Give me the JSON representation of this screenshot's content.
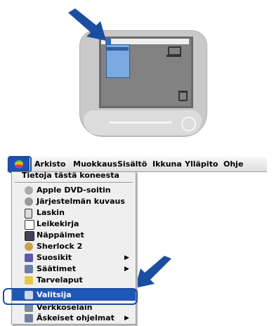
{
  "menubar": {
    "items": [
      {
        "label": "Arkisto"
      },
      {
        "label": "Muokkaus"
      },
      {
        "label": "Sisältö"
      },
      {
        "label": "Ikkuna"
      },
      {
        "label": "Ylläpito"
      },
      {
        "label": "Ohje"
      }
    ]
  },
  "apple_menu": {
    "header": "Tietoja tästä koneesta",
    "items": [
      {
        "label": "Apple DVD-soitin",
        "icon": "dvd-icon"
      },
      {
        "label": "Järjestelmän kuvaus",
        "icon": "system-profile-icon"
      },
      {
        "label": "Laskin",
        "icon": "calculator-icon"
      },
      {
        "label": "Leikekirja",
        "icon": "scrapbook-icon"
      },
      {
        "label": "Näppäimet",
        "icon": "key-caps-icon"
      },
      {
        "label": "Sherlock 2",
        "icon": "sherlock-icon"
      },
      {
        "label": "Suosikit",
        "icon": "favorites-icon",
        "submenu": true
      },
      {
        "label": "Säätimet",
        "icon": "control-panels-icon",
        "submenu": true
      },
      {
        "label": "Tarvelaput",
        "icon": "stickies-icon"
      },
      {
        "label": "Valitsija",
        "icon": "chooser-icon",
        "selected": true
      },
      {
        "label": "Verkkoselain",
        "icon": "network-browser-icon"
      },
      {
        "label": "Äskeiset ohjelmat",
        "icon": "recent-apps-icon",
        "submenu": true
      }
    ],
    "submenu_glyph": "▶"
  },
  "colors": {
    "highlight": "#1f57b7",
    "arrow": "#1a4fa0"
  }
}
